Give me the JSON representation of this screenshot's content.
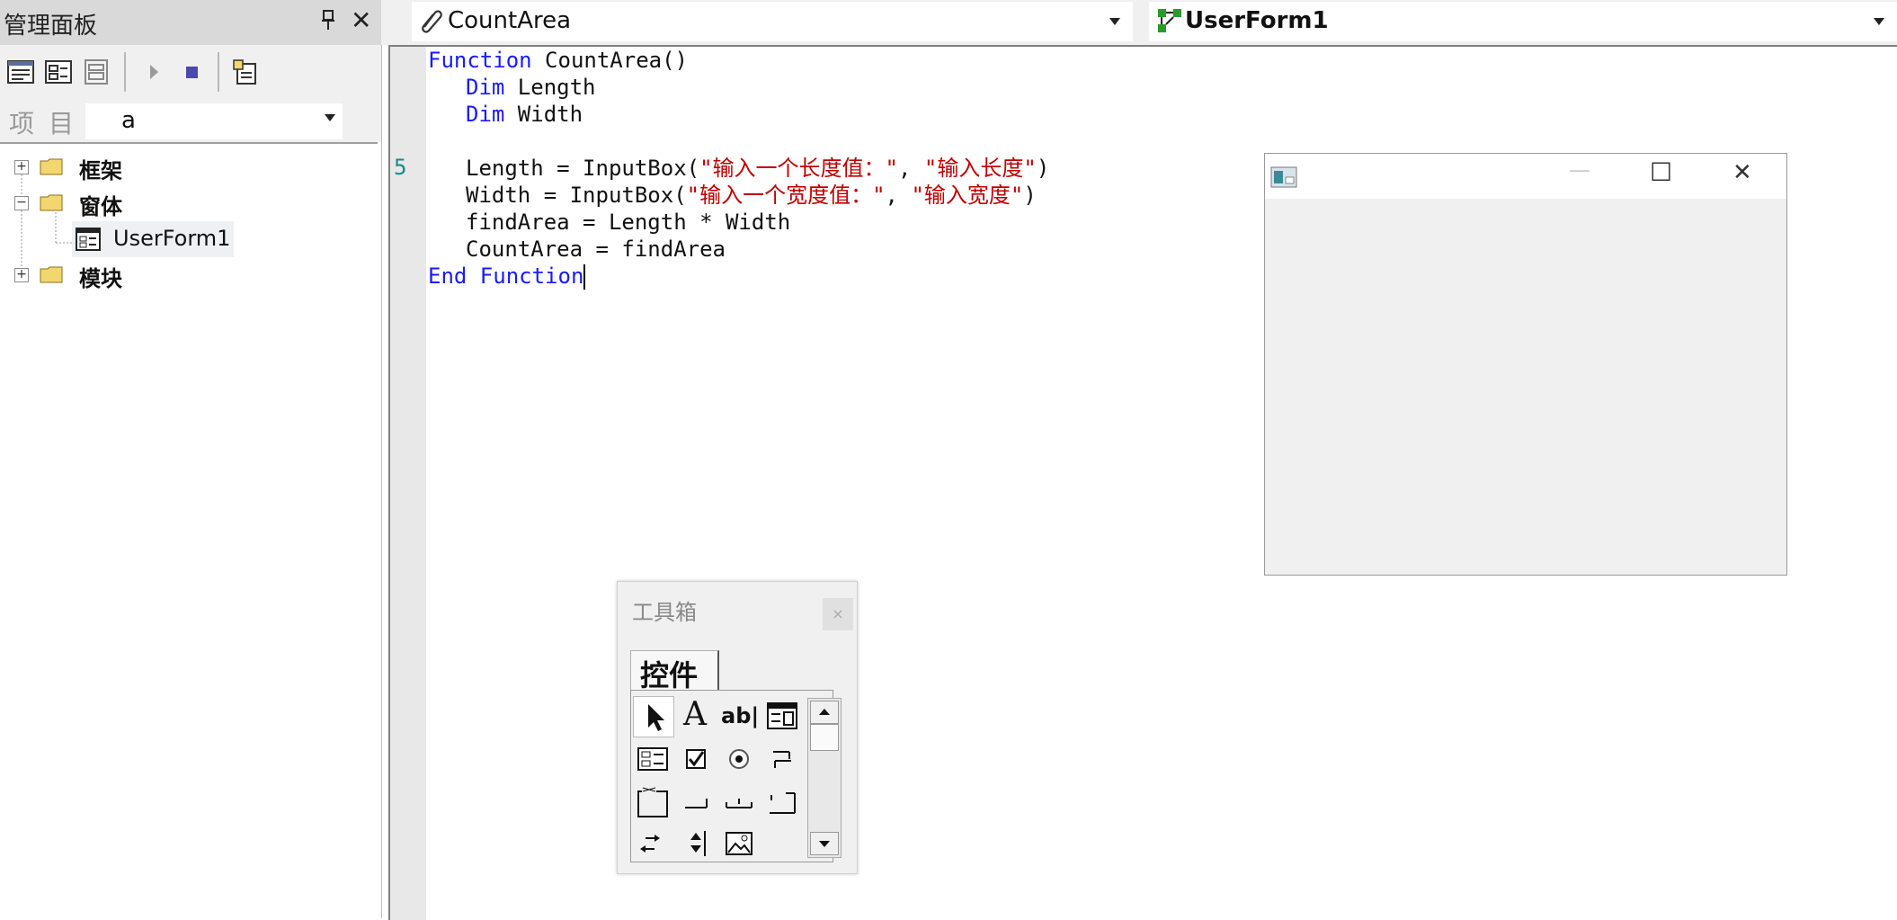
{
  "panel": {
    "title": "管理面板",
    "pin_glyph": "📌",
    "close_glyph": "✕"
  },
  "project": {
    "label": "项目",
    "value": "a"
  },
  "tree": {
    "items": [
      {
        "label": "框架",
        "expander": "+"
      },
      {
        "label": "窗体",
        "expander": "−"
      },
      {
        "label": "UserForm1"
      },
      {
        "label": "模块",
        "expander": "+"
      }
    ]
  },
  "combos": {
    "object_value": "CountArea",
    "procedure_value": "UserForm1"
  },
  "code": {
    "line_number": "5",
    "l1_kw": "Function",
    "l1_rest": " CountArea()",
    "l2_kw": "Dim",
    "l2_rest": " Length",
    "l3_kw": "Dim",
    "l3_rest": " Width",
    "l5_a": "Length = InputBox(",
    "l5_s1": "\"输入一个长度值：\"",
    "l5_c": ", ",
    "l5_s2": "\"输入长度\"",
    "l5_e": ")",
    "l6_a": "Width = InputBox(",
    "l6_s1": "\"输入一个宽度值：\"",
    "l6_c": ", ",
    "l6_s2": "\"输入宽度\"",
    "l6_e": ")",
    "l7": "findArea = Length * Width",
    "l8": "CountArea = findArea",
    "l9_kw": "End Function"
  },
  "toolbox": {
    "title": "工具箱",
    "tab": "控件",
    "close_glyph": "×",
    "label_a": "A",
    "textbox_glyph": "ab|"
  },
  "userform": {
    "minimize_glyph": "—",
    "maximize_glyph": "☐",
    "close_glyph": "✕"
  },
  "colors": {
    "keyword": "#1a1aff",
    "string": "#c00000",
    "line_number": "#1a8a8a"
  }
}
